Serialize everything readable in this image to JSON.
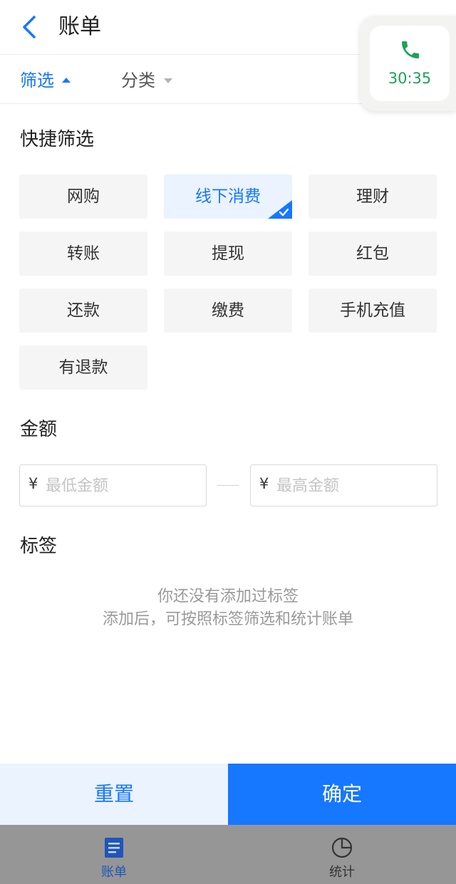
{
  "header": {
    "title": "账单"
  },
  "filter_bar": {
    "screen_label": "筛选",
    "category_label": "分类"
  },
  "call_overlay": {
    "time": "30:35"
  },
  "quick_filter": {
    "title": "快捷筛选",
    "chips": [
      "网购",
      "线下消费",
      "理财",
      "转账",
      "提现",
      "红包",
      "还款",
      "缴费",
      "手机充值",
      "有退款"
    ],
    "selected": "线下消费"
  },
  "amount": {
    "title": "金额",
    "currency": "¥",
    "min_placeholder": "最低金额",
    "max_placeholder": "最高金额"
  },
  "tags": {
    "title": "标签",
    "empty_line1": "你还没有添加过标签",
    "empty_line2": "添加后，可按照标签筛选和统计账单"
  },
  "actions": {
    "reset_label": "重置",
    "confirm_label": "确定"
  },
  "tabbar": {
    "bill_label": "账单",
    "stats_label": "统计"
  },
  "colors": {
    "accent": "#1677ff",
    "call_green": "#1aa35a",
    "chip_bg": "#f5f5f5",
    "chip_selected_bg": "#eaf3ff"
  }
}
